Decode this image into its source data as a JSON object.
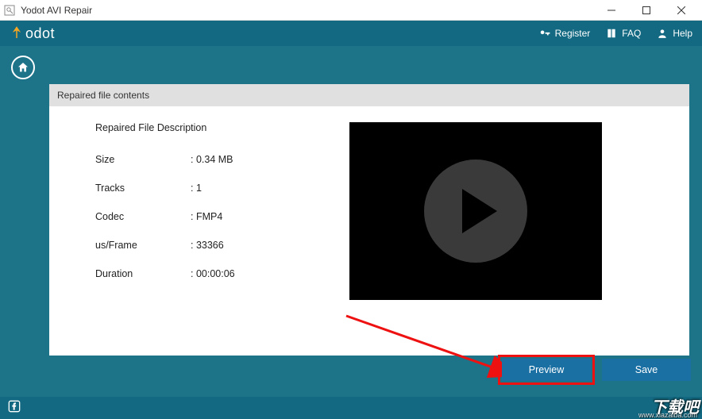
{
  "window": {
    "title": "Yodot AVI Repair"
  },
  "header": {
    "logo_main": "odot",
    "register": "Register",
    "faq": "FAQ",
    "help": "Help"
  },
  "panel": {
    "header": "Repaired file contents",
    "desc_title": "Repaired File Description",
    "fields": {
      "size_label": "Size",
      "size_value": ": 0.34 MB",
      "tracks_label": "Tracks",
      "tracks_value": ": 1",
      "codec_label": "Codec",
      "codec_value": ": FMP4",
      "usframe_label": "us/Frame",
      "usframe_value": ": 33366",
      "duration_label": "Duration",
      "duration_value": ": 00:00:06"
    }
  },
  "buttons": {
    "preview": "Preview",
    "save": "Save"
  },
  "watermark": {
    "main": "下载吧",
    "sub": "www.xiazaiba.com"
  }
}
